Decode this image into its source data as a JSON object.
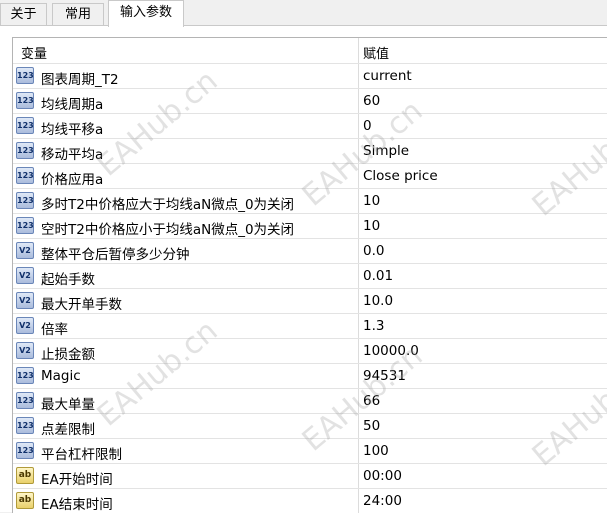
{
  "tabs": [
    {
      "label": "关于"
    },
    {
      "label": "常用"
    },
    {
      "label": "输入参数"
    }
  ],
  "columns": {
    "variable": "变量",
    "value": "赋值"
  },
  "rows": [
    {
      "name": "图表周期_T2",
      "value": "current",
      "icon": "123"
    },
    {
      "name": "均线周期a",
      "value": "60",
      "icon": "123"
    },
    {
      "name": "均线平移a",
      "value": "0",
      "icon": "123"
    },
    {
      "name": "移动平均a",
      "value": "Simple",
      "icon": "123"
    },
    {
      "name": "价格应用a",
      "value": "Close price",
      "icon": "123"
    },
    {
      "name": "多时T2中价格应大于均线aN微点_0为关闭",
      "value": "10",
      "icon": "123"
    },
    {
      "name": "空时T2中价格应小于均线aN微点_0为关闭",
      "value": "10",
      "icon": "123"
    },
    {
      "name": "整体平仓后暂停多少分钟",
      "value": "0.0",
      "icon": "V2"
    },
    {
      "name": "起始手数",
      "value": "0.01",
      "icon": "V2"
    },
    {
      "name": "最大开单手数",
      "value": "10.0",
      "icon": "V2"
    },
    {
      "name": "倍率",
      "value": "1.3",
      "icon": "V2"
    },
    {
      "name": "止损金额",
      "value": "10000.0",
      "icon": "V2"
    },
    {
      "name": "Magic",
      "value": "94531",
      "icon": "123"
    },
    {
      "name": "最大单量",
      "value": "66",
      "icon": "123"
    },
    {
      "name": "点差限制",
      "value": "50",
      "icon": "123"
    },
    {
      "name": "平台杠杆限制",
      "value": "100",
      "icon": "123"
    },
    {
      "name": "EA开始时间",
      "value": "00:00",
      "icon": "ab"
    },
    {
      "name": "EA结束时间",
      "value": "24:00",
      "icon": "ab"
    }
  ],
  "watermark": "EAHub.cn"
}
